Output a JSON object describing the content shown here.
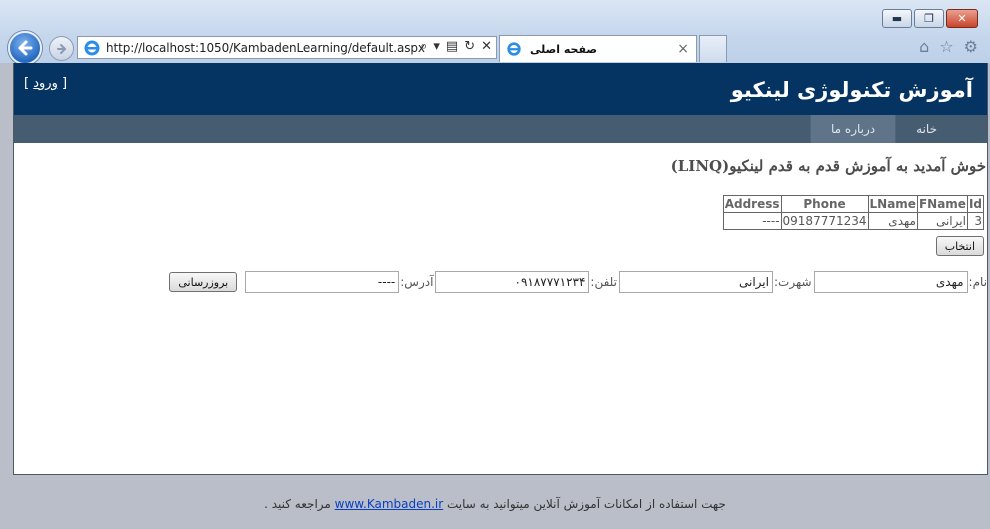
{
  "browser": {
    "url": "http://localhost:1050/KambadenLearning/default.aspx",
    "tab_title": "صفحه اصلی",
    "tab_close": "×",
    "win_minimize": "▬",
    "win_restore": "❐",
    "win_close": "✕"
  },
  "header": {
    "site_title": "آموزش تکنولوژی لینکیو",
    "login_label": "ورود",
    "login_open": "[",
    "login_close": "]"
  },
  "menu": {
    "home": "خانه",
    "about": "درباره ما"
  },
  "main": {
    "welcome": "خوش آمدید به آموزش قدم به قدم لینکیو(LINQ)",
    "grid": {
      "columns": [
        "Id",
        "FName",
        "LName",
        "Phone",
        "Address"
      ],
      "rows": [
        [
          "3",
          "ایرانی",
          "مهدی",
          "09187771234",
          "----"
        ]
      ]
    },
    "select_button": "انتخاب",
    "form": {
      "name_label": "نام:",
      "name_value": "مهدی",
      "lname_label": "شهرت:",
      "lname_value": "ایرانی",
      "phone_label": "تلفن:",
      "phone_value": "۰۹۱۸۷۷۷۱۲۳۴",
      "address_label": "آدرس:",
      "address_value": "----",
      "update_button": "بروزرسانی"
    }
  },
  "footer": {
    "text_before": "جهت استفاده از امکانات آموزش آنلاین میتوانید به سایت",
    "link": "www.Kambaden.ir",
    "text_after": "مراجعه کنید ."
  }
}
